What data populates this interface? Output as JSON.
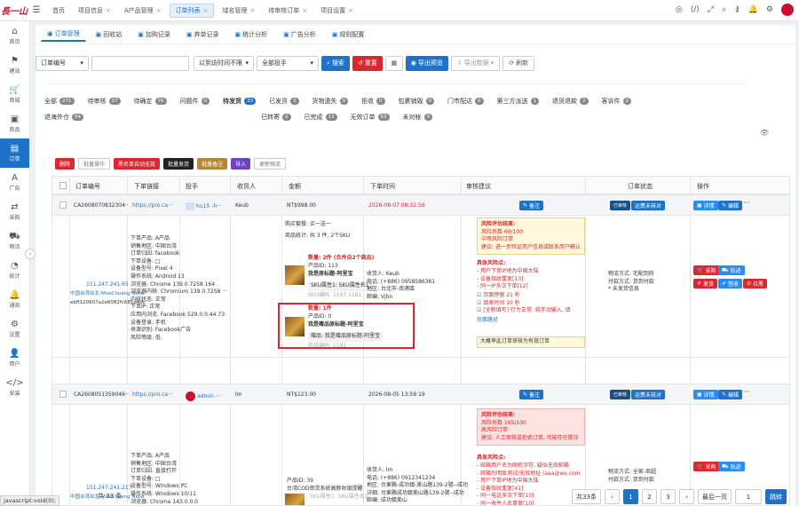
{
  "app": {
    "logo": "長一山"
  },
  "tabs": [
    {
      "label": "首页",
      "active": false
    },
    {
      "label": "项目信息",
      "active": false
    },
    {
      "label": "A产品管理",
      "active": false
    },
    {
      "label": "订单列表",
      "active": true
    },
    {
      "label": "域名管理",
      "active": false
    },
    {
      "label": "待审核订单",
      "active": false
    },
    {
      "label": "项目设置",
      "active": false
    }
  ],
  "sidebar": [
    {
      "icon": "home-icon",
      "glyph": "⌂",
      "label": "首页"
    },
    {
      "icon": "site-icon",
      "glyph": "⚑",
      "label": "建站"
    },
    {
      "icon": "cart-icon",
      "glyph": "🛒",
      "label": "商城"
    },
    {
      "icon": "goods-icon",
      "glyph": "▣",
      "label": "商品"
    },
    {
      "icon": "order-icon",
      "glyph": "▤",
      "label": "订单"
    },
    {
      "icon": "ad-icon",
      "glyph": "A",
      "label": "广告"
    },
    {
      "icon": "purchase-icon",
      "glyph": "⇄",
      "label": "采购"
    },
    {
      "icon": "logistics-icon",
      "glyph": "⛟",
      "label": "物流"
    },
    {
      "icon": "stats-icon",
      "glyph": "◔",
      "label": "统计"
    },
    {
      "icon": "notice-icon",
      "glyph": "🔔",
      "label": "通知"
    },
    {
      "icon": "settings-icon",
      "glyph": "⚙",
      "label": "设置"
    },
    {
      "icon": "user-icon",
      "glyph": "👤",
      "label": "用户"
    },
    {
      "icon": "install-icon",
      "glyph": "</>",
      "label": "安装"
    }
  ],
  "subnav": [
    {
      "label": "订单管理",
      "active": true
    },
    {
      "label": "回收站"
    },
    {
      "label": "加购记录"
    },
    {
      "label": "弃单记录"
    },
    {
      "label": "统计分析"
    },
    {
      "label": "广告分析"
    },
    {
      "label": "规则配置"
    }
  ],
  "filters": {
    "field": "订单编号",
    "keyword_placeholder": "",
    "time_range": "以到访时间不限",
    "delivery": "全部投手",
    "search": "搜索",
    "reset": "重置",
    "export_preview": "导出预览",
    "export_data": "导出数据",
    "refresh": "刷新"
  },
  "status_tabs": [
    {
      "label": "全部",
      "count": "271"
    },
    {
      "label": "待审核",
      "count": "27"
    },
    {
      "label": "待确定",
      "count": "76"
    },
    {
      "label": "问题件",
      "count": "0"
    },
    {
      "label": "待发货",
      "count": "33",
      "active": true
    },
    {
      "label": "已发货",
      "count": "3"
    },
    {
      "label": "货物遗失",
      "count": "0"
    },
    {
      "label": "拒收",
      "count": "0"
    },
    {
      "label": "包裹销毁",
      "count": "0"
    },
    {
      "label": "门市配达",
      "count": "0"
    },
    {
      "label": "第三方派送",
      "count": "1"
    },
    {
      "label": "退货退款",
      "count": "2"
    },
    {
      "label": "客诉件",
      "count": "0"
    },
    {
      "label": "退海外仓",
      "count": "54"
    },
    {
      "label": "已转寄",
      "count": "0"
    },
    {
      "label": "已完成",
      "count": "13"
    },
    {
      "label": "无效订单",
      "count": "63"
    },
    {
      "label": "未对帐",
      "count": "9"
    }
  ],
  "actions": [
    {
      "label": "删除",
      "style": "red"
    },
    {
      "label": "批量操作",
      "style": "grey"
    },
    {
      "label": "黑名单自动无效",
      "style": "red"
    },
    {
      "label": "批量发货",
      "style": "black"
    },
    {
      "label": "批量备注",
      "style": "brown"
    },
    {
      "label": "导入",
      "style": "purple"
    },
    {
      "label": "更新物流",
      "style": "grey"
    }
  ],
  "columns": [
    "订单编号",
    "下单链接",
    "投手",
    "收货人",
    "金额",
    "下单时间",
    "审核建议",
    "订单状态",
    "操作"
  ],
  "orders": [
    {
      "id": "CA2608070832304··",
      "link": "https://pro.ca···",
      "agent": "hu15 -h···",
      "consignee": "Keub",
      "amount": "NT$998.00",
      "time": "2026-08-07 08:32:56",
      "remark_btn": "备注",
      "status_tag": "已审核",
      "status_btn": "运费未核对",
      "op": [
        "详情",
        "编辑"
      ],
      "ip": "151.247.241.65",
      "ip_loc": "中国台湾台北-MoeChuang Netw",
      "ua": "ebff120607a2e6082fc685d4dc",
      "info": [
        "下单产品: A产品",
        "销售地区: 中国台湾",
        "订单归因: facebook",
        "下单设备: □",
        "设备型号: Pixel 4",
        "操作系统: Android 13",
        "浏览器: Chrome 139.0.7258.164",
        "浏览器内核: Chromium 139.0.7258 ···",
        "内核状态: 正常",
        "下单IP: 正常",
        "应用内浏览: Facebook 529.0.0.44.73",
        "设备登录: 手机",
        "来源识别: Facebook广告",
        "风险等级: 低"
      ],
      "buy_combo": "购买套餐: 买一送一",
      "goods_stat": "商品统计: 共 3 件, 2个SKU",
      "sku1_qty": "数量: 2件 (合并自2个商品)",
      "sku1_id": "产品ID: 113",
      "sku1_title": "我是原标题-阿里宝",
      "sku1_attr": "SKU属性1: SKU属性名1",
      "sku1_code": "SKU编码: 1197  1181",
      "sku2_qty": "数量: 1件",
      "sku2_id": "产品ID: 0",
      "sku2_title": "我是赠品原标题-阿里宝",
      "sku2_gift": "赠品: 我是赠品原标题-阿里宝",
      "sku2_code": "商品编码: 1181",
      "addr": [
        "收货人: Keub",
        "电话: (+886) 0958586361",
        "地区: 台北市-南港區",
        "邮编: Vjbn"
      ],
      "risk_title": "风险评估结果:",
      "risk_lines": [
        "风险系数 60/100",
        "中等风险订单",
        "建议: 进一步验证用户信息或联系用户确认"
      ],
      "risk_detail_title": "具体风险点:",
      "risk_points": [
        "- 用户下单IP地为中国大陆",
        "- 设备指纹重复[13]",
        "- 同一IP多次下单[12]"
      ],
      "checks": [
        "页面停留 21 秒",
        "填表时间 10 秒",
        "[全新填写] 行为正常: 纯手动输入, 填"
      ],
      "record": "页面路径",
      "agree": "大概率此订单审核为有效订单",
      "logistics": [
        "物流方式: 宅配到府",
        "付款方式: 货到付款",
        "* 未发货信息"
      ],
      "op2": [
        "采购",
        "轨迹",
        "发货",
        "签收",
        "拉黑"
      ]
    },
    {
      "id": "CA2608051359046··",
      "link": "https://pro.ca···",
      "agent": "admin -···",
      "consignee": "lm",
      "amount": "NT$123.00",
      "time": "2026-08-05 13:59:19",
      "remark_btn": "备注",
      "status_tag": "已审核",
      "status_btn": "运费未核对",
      "op": [
        "详情",
        "编辑"
      ],
      "ip": "151.247.241.217",
      "ip_loc": "中国台湾台北-MoeChuang Netw",
      "info": [
        "下单产品: A产品",
        "销售地区: 中国台湾",
        "订单归因: 直接打开",
        "下单设备: □",
        "设备型号: Windows PC",
        "操作系统: Windows 10/11",
        "浏览器: Chrome 143.0.0.0"
      ],
      "sku_id": "产品ID: 39",
      "sku_title": "台湾COD审货系统高颜收银提醒",
      "sku_attr": "SKU属性1: SKU属性名1",
      "addr": [
        "收货人: lm",
        "电话: (+886) 0912341234",
        "地区: 台東縣-成功鎮-美山路139-2號--成功",
        "详细: 台東縣成功鎮美山路139-2號--成功",
        "邮编: 成功鎮美山"
      ],
      "risk_title": "风险评估结果:",
      "risk_lines": [
        "风险系数 165/100",
        "高风险订单",
        "建议: 人工审核或拒绝订单, 可能存在欺诈"
      ],
      "risk_detail_title": "具体风险点:",
      "risk_points": [
        "- 邮箱用户名为随机字符, 疑似无效邮箱",
        "- 邮箱为明显测试/无效地址 (aaa@wx.com",
        "- 用户下单IP地为中国大陆",
        "- 设备指纹重复[41]",
        "- 同一电话多次下单[10]",
        "- 同一收件人名重复[10]"
      ],
      "logistics": [
        "物流方式: 全家-商超",
        "付款方式: 货到付款"
      ],
      "op2": [
        "采购",
        "轨迹"
      ]
    }
  ],
  "pager": {
    "total": "共 33 条",
    "total_right": "共33条",
    "pages": [
      "1",
      "2",
      "3"
    ],
    "current": "1",
    "prev": "最后一页",
    "jump": "1",
    "go": "跳转"
  },
  "statusbar": "javascript:void(0);"
}
